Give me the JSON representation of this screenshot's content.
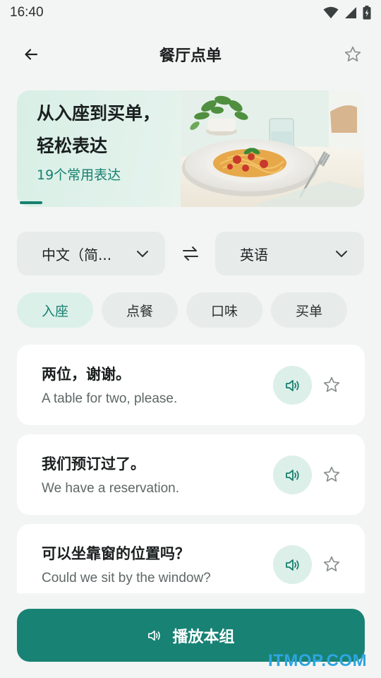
{
  "status_bar": {
    "time": "16:40",
    "icons": [
      "wifi-icon",
      "cellular-signal-icon",
      "battery-charging-icon"
    ]
  },
  "header": {
    "title": "餐厅点单",
    "back_icon": "arrow-left-icon",
    "favorite_icon": "star-outline-icon"
  },
  "banner": {
    "title": "从入座到买单，\n轻松表达",
    "subtitle": "19个常用表达",
    "image": "pasta-dish-on-table-illustration"
  },
  "languages": {
    "source": "中文（简...",
    "target": "英语",
    "swap_icon": "swap-arrows-icon",
    "dropdown_icon": "chevron-down-icon"
  },
  "tabs": [
    {
      "label": "入座",
      "active": true
    },
    {
      "label": "点餐",
      "active": false
    },
    {
      "label": "口味",
      "active": false
    },
    {
      "label": "买单",
      "active": false
    }
  ],
  "phrases": [
    {
      "zh": "两位，谢谢。",
      "en": "A table for two, please."
    },
    {
      "zh": "我们预订过了。",
      "en": "We have a reservation."
    },
    {
      "zh": "可以坐靠窗的位置吗？",
      "en": "Could we sit by the window?"
    }
  ],
  "play_group": {
    "label": "播放本组",
    "icon": "speaker-icon"
  },
  "watermark": "ITMOP.COM",
  "colors": {
    "accent": "#188274",
    "accent_light": "#dcf0ea",
    "background": "#f3f5f4",
    "chip": "#e7ebea"
  }
}
